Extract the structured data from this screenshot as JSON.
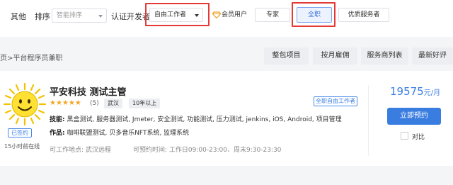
{
  "filters": {
    "other_label": "其他",
    "sort_label": "排序",
    "sort_placeholder": "智能排序",
    "auth_dev_label": "认证开发者",
    "freelancer_select_value": "自由工作者",
    "member_label": "会员用户",
    "expert_label": "专家",
    "fulltime_label": "全职",
    "quality_label": "优质服务者"
  },
  "breadcrumb": "页>平台程序员兼职",
  "tabs": [
    "整包项目",
    "按月雇佣",
    "服务商列表",
    "最新好评"
  ],
  "card": {
    "name": "平安科技 测试主管",
    "stars": "★★★★★",
    "review_count": "(5)",
    "city_tag": "武汉",
    "exp_tag": "10年以上",
    "status_badge": "全职自由工作者",
    "skills_label": "技能:",
    "skills_value": " 黑盒测试, 服务器测试, Jmeter, 安全测试, 功能测试, 压力测试, jenkins, iOS, Android, 项目管理",
    "works_label": "作品:",
    "works_value": " 咖啡联盟测试, 贝多音乐NFT系统, 监理系统",
    "work_location": "可工作地点:  武汉远程",
    "booking_time": "可预约时间:  工作日09:00-23:00、周末9:30-23:30",
    "verified_badge": "已签约",
    "online_status": "15小时前在线",
    "price_value": "19575",
    "price_unit": "元/月",
    "book_button": "立即预约",
    "compare_label": "对比"
  },
  "colors": {
    "accent": "#3a7de0",
    "highlight_box": "#e53935",
    "star": "#f5a623"
  }
}
